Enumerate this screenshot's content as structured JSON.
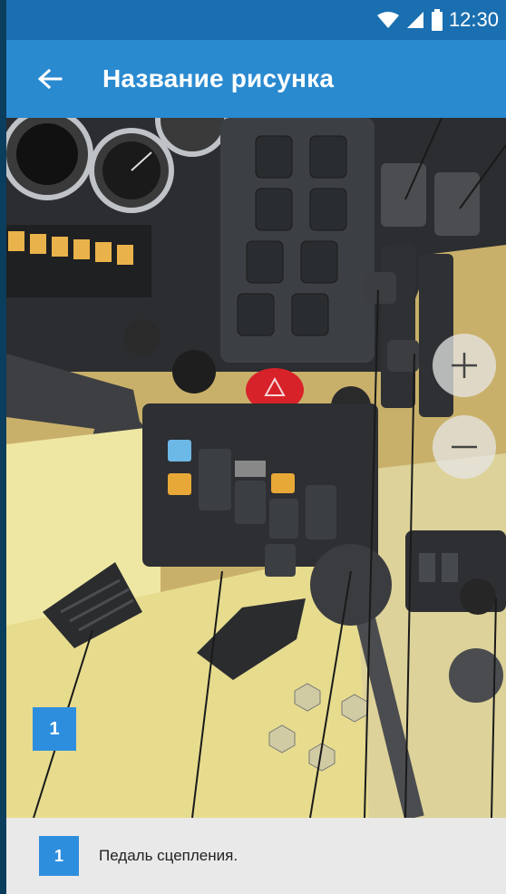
{
  "status_bar": {
    "time": "12:30"
  },
  "app_bar": {
    "title": "Название рисунка"
  },
  "zoom": {
    "in_label": "+",
    "out_label": "−"
  },
  "marker": {
    "number": "1"
  },
  "caption": {
    "number": "1",
    "text": "Педаль сцепления."
  }
}
